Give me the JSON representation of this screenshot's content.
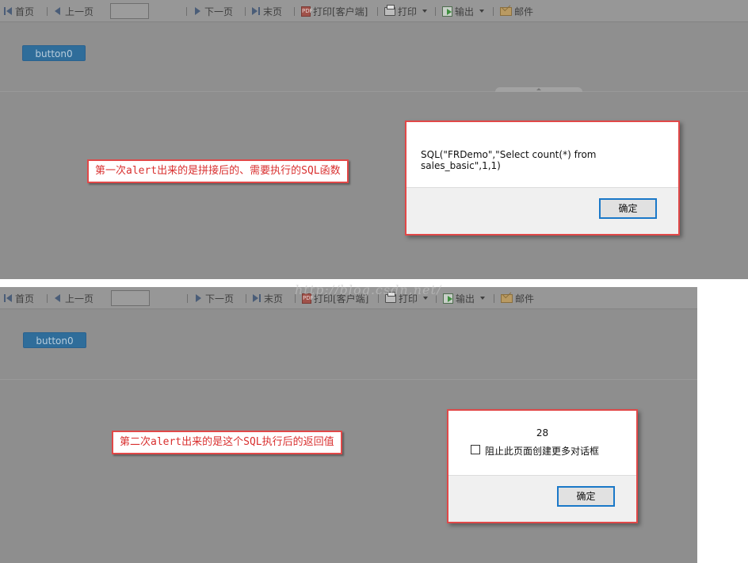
{
  "toolbar": {
    "first": "首页",
    "prev": "上一页",
    "page_value": "",
    "next": "下一页",
    "last": "末页",
    "print_client": "打印[客户端]",
    "print": "打印",
    "export": "输出",
    "email": "邮件",
    "pdf_icon_text": "PDF"
  },
  "form": {
    "button_label": "button0"
  },
  "screen1": {
    "annotation": "第一次alert出来的是拼接后的、需要执行的SQL函数",
    "alert": {
      "message": "SQL(\"FRDemo\",\"Select count(*) from sales_basic\",1,1)",
      "ok_label": "确定"
    }
  },
  "screen2": {
    "annotation": "第二次alert出来的是这个SQL执行后的返回值",
    "alert": {
      "message": "28",
      "checkbox_label": "阻止此页面创建更多对话框",
      "checkbox_checked": false,
      "ok_label": "确定"
    }
  },
  "watermark": "http://blog.csdn.net/"
}
